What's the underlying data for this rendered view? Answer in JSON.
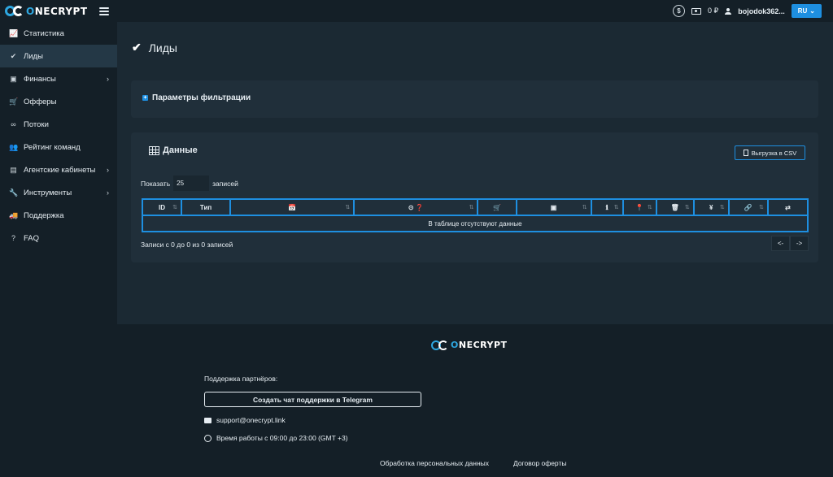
{
  "header": {
    "logo_text_a": "O",
    "logo_text_b": "NECRYPT",
    "coin_symbol": "$",
    "balance": "0 ₽",
    "username": "bojodok362...",
    "lang": "RU",
    "lang_chevron": "⌄"
  },
  "sidebar": {
    "items": [
      {
        "label": "Статистика",
        "icon": "chart-icon",
        "glyph": "📈"
      },
      {
        "label": "Лиды",
        "icon": "check-circle-icon",
        "glyph": "✔"
      },
      {
        "label": "Финансы",
        "icon": "money-icon",
        "glyph": "▣"
      },
      {
        "label": "Офферы",
        "icon": "cart-icon",
        "glyph": "🛒"
      },
      {
        "label": "Потоки",
        "icon": "link-icon",
        "glyph": "∞"
      },
      {
        "label": "Рейтинг команд",
        "icon": "team-icon",
        "glyph": "👥"
      },
      {
        "label": "Агентские кабинеты",
        "icon": "briefcase-icon",
        "glyph": "▤"
      },
      {
        "label": "Инструменты",
        "icon": "wrench-icon",
        "glyph": "🔧"
      },
      {
        "label": "Поддержка",
        "icon": "truck-icon",
        "glyph": "🚚"
      },
      {
        "label": "FAQ",
        "icon": "question-icon",
        "glyph": "?"
      }
    ],
    "chevron": "›"
  },
  "page": {
    "title": "Лиды"
  },
  "filter": {
    "title": "Параметры фильтрации"
  },
  "data_card": {
    "title": "Данные",
    "csv_button": "Выгрузка в CSV",
    "show_label": "Показать",
    "page_length": "25",
    "records_label": "записей",
    "columns": [
      {
        "label": "ID",
        "sortable": true
      },
      {
        "label": "Тип",
        "sortable": false
      },
      {
        "label": "📅",
        "sortable": true,
        "icon": "calendar-icon"
      },
      {
        "label": "⊙ ❓",
        "sortable": true,
        "icon": "clock-question-icon"
      },
      {
        "label": "🛒",
        "sortable": false,
        "icon": "cart-icon"
      },
      {
        "label": "▣",
        "sortable": true,
        "icon": "money-icon"
      },
      {
        "label": "ℹ",
        "sortable": true,
        "icon": "info-icon"
      },
      {
        "label": "📍",
        "sortable": true,
        "icon": "location-icon"
      },
      {
        "label": "🗑",
        "sortable": true,
        "icon": "trash-icon"
      },
      {
        "label": "¥",
        "sortable": true,
        "icon": "yen-icon"
      },
      {
        "label": "🔗",
        "sortable": true,
        "icon": "link-icon"
      },
      {
        "label": "⇄",
        "sortable": false,
        "icon": "exchange-icon"
      }
    ],
    "sort_glyph": "⇅",
    "empty_text": "В таблице отсутствуют данные",
    "info_text": "Записи с 0 до 0 из 0 записей",
    "prev": "<-",
    "next": "->"
  },
  "footer": {
    "support_label": "Поддержка партнёров:",
    "telegram_button": "Создать чат поддержки в Telegram",
    "email": "support@onecrypt.link",
    "hours": "Время работы с 09:00 до 23:00 (GMT +3)",
    "links": [
      "Обработка персональных данных",
      "Договор оферты"
    ]
  },
  "colors": {
    "accent": "#1e8fe0",
    "logo_blue": "#2ea7e0",
    "background": "#1b2933",
    "sidebar": "#141f27",
    "card": "#202f3a"
  }
}
